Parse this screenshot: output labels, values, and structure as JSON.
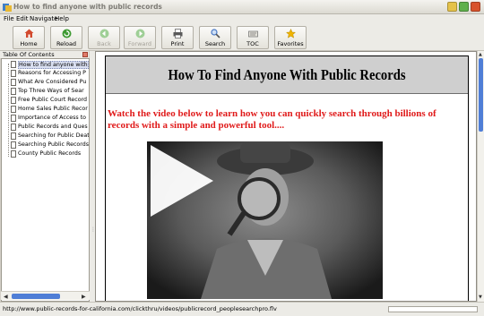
{
  "window": {
    "title": "How to find anyone with public records"
  },
  "menu": [
    "File",
    "Edit",
    "Navigate",
    "Help"
  ],
  "toolbar": [
    {
      "label": "Home",
      "icon": "home-icon",
      "enabled": true,
      "color": "#d24a2e"
    },
    {
      "label": "Reload",
      "icon": "reload-icon",
      "enabled": true,
      "color": "#3e9a32"
    },
    {
      "label": "Back",
      "icon": "back-icon",
      "enabled": false,
      "color": "#9fcf96"
    },
    {
      "label": "Forward",
      "icon": "forward-icon",
      "enabled": false,
      "color": "#9fcf96"
    },
    {
      "label": "Print",
      "icon": "print-icon",
      "enabled": true,
      "color": "#5a5a5a"
    },
    {
      "label": "Search",
      "icon": "search-icon",
      "enabled": true,
      "color": "#4a78c4"
    },
    {
      "label": "TOC",
      "icon": "toc-icon",
      "enabled": true,
      "color": "#6a6a6a"
    },
    {
      "label": "Favorites",
      "icon": "star-icon",
      "enabled": true,
      "color": "#f0b400"
    }
  ],
  "toc": {
    "header": "Table Of Contents",
    "items": [
      {
        "label": "How to find anyone with",
        "selected": true
      },
      {
        "label": "Reasons for Accessing P",
        "selected": false
      },
      {
        "label": "What Are Considered Pu",
        "selected": false
      },
      {
        "label": "Top Three Ways of Sear",
        "selected": false
      },
      {
        "label": "Free Public Court Record",
        "selected": false
      },
      {
        "label": "Home Sales Public Recor",
        "selected": false
      },
      {
        "label": "Importance of Access to",
        "selected": false
      },
      {
        "label": "Public Records and Ques",
        "selected": false
      },
      {
        "label": "Searching for Public Deat",
        "selected": false
      },
      {
        "label": "Searching Public Records",
        "selected": false
      },
      {
        "label": "County Public Records",
        "selected": false
      }
    ]
  },
  "content": {
    "heading": "How To Find Anyone With Public Records",
    "intro": "Watch the video below to learn how you can quickly search through billions of records with a simple and powerful tool....",
    "video": {
      "icon": "play-icon"
    }
  },
  "status": {
    "url": "http://www.public-records-for-california.com/clickthru/videos/publicrecord_peoplesearchpro.flv"
  },
  "colors": {
    "intro_text": "#e01a1a",
    "scroll_thumb": "#4f7ed6",
    "header_band": "#cfcfcf"
  }
}
